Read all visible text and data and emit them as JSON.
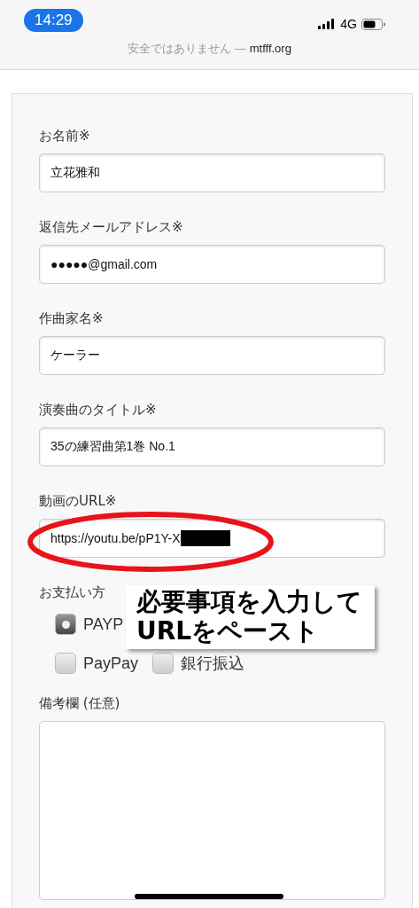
{
  "status_bar": {
    "time": "14:29",
    "network": "4G"
  },
  "address_bar": {
    "warning": "安全ではありません —",
    "domain": "mtfff.org"
  },
  "form": {
    "fields": [
      {
        "kind": "text",
        "label": "お名前※",
        "value": "立花雅和"
      },
      {
        "kind": "text",
        "label": "返信先メールアドレス※",
        "value": "●●●●●@gmail.com"
      },
      {
        "kind": "text",
        "label": "作曲家名※",
        "value": "ケーラー"
      },
      {
        "kind": "text",
        "label": "演奏曲のタイトル※",
        "value": "35の練習曲第1巻 No.1"
      },
      {
        "kind": "url",
        "label": "動画のURL※",
        "value": "https://youtu.be/pP1Y-X",
        "redacted": true
      },
      {
        "kind": "radio",
        "label": "お支払い方",
        "options": [
          {
            "label": "PAYP",
            "selected": true
          },
          {
            "label": "PayPay",
            "selected": false
          },
          {
            "label": "銀行振込",
            "selected": false
          }
        ]
      },
      {
        "kind": "textarea",
        "label": "備考欄 (任意)"
      }
    ]
  },
  "annotation": {
    "lines": [
      "必要事項を入力して",
      "URLをペースト"
    ]
  }
}
